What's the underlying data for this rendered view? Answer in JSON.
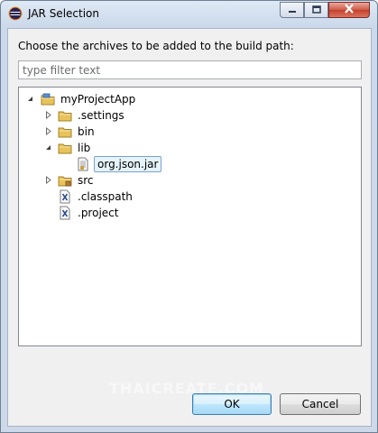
{
  "window": {
    "title": "JAR Selection",
    "controls": {
      "minimize": "minimize",
      "maximize": "maximize",
      "close": "close"
    }
  },
  "dialog": {
    "prompt": "Choose the archives to be added to the build path:",
    "filter": {
      "value": "",
      "placeholder": "type filter text"
    }
  },
  "tree": {
    "root": {
      "label": "myProjectApp",
      "icon": "project-folder-icon",
      "expanded": true
    },
    "items": [
      {
        "label": ".settings",
        "icon": "folder-icon",
        "expanded": false
      },
      {
        "label": "bin",
        "icon": "folder-icon",
        "expanded": false
      },
      {
        "label": "lib",
        "icon": "folder-icon",
        "expanded": true
      },
      {
        "label": "org.json.jar",
        "icon": "jar-file-icon",
        "selected": true
      },
      {
        "label": "src",
        "icon": "package-folder-icon",
        "expanded": false
      },
      {
        "label": ".classpath",
        "icon": "xml-file-icon"
      },
      {
        "label": ".project",
        "icon": "xml-file-icon"
      }
    ]
  },
  "buttons": {
    "ok": "OK",
    "cancel": "Cancel"
  },
  "watermark": "THAICREATE.COM",
  "colors": {
    "selection_bg": "#e5f3fb",
    "selection_border": "#7da2ce",
    "folder": "#e8c35a",
    "close_button": "#c6402b"
  }
}
